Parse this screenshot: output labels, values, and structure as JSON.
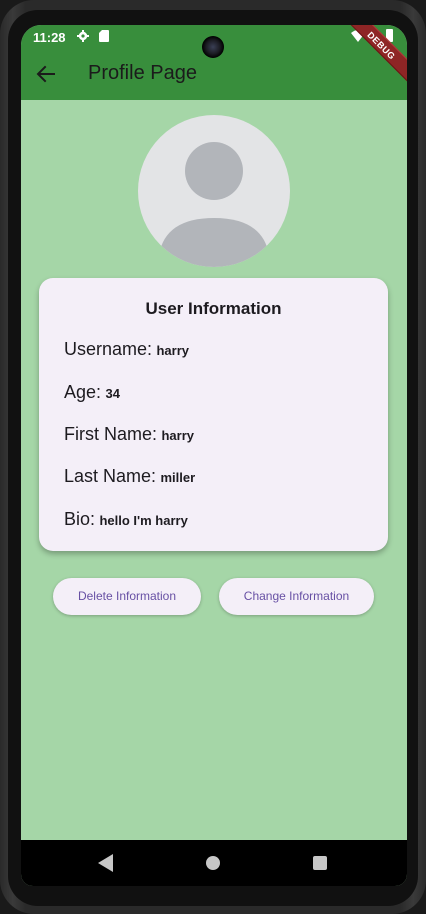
{
  "status_bar": {
    "time": "11:28",
    "debug_banner": "DEBUG"
  },
  "app_bar": {
    "title": "Profile Page",
    "back_icon": "arrow-left-icon"
  },
  "avatar": {
    "icon": "person-icon"
  },
  "card": {
    "title": "User Information",
    "rows": [
      {
        "label": "Username:",
        "value": "harry"
      },
      {
        "label": "Age:",
        "value": "34"
      },
      {
        "label": "First Name:",
        "value": "harry"
      },
      {
        "label": "Last Name:",
        "value": "miller"
      },
      {
        "label": "Bio:",
        "value": "hello I'm harry"
      }
    ]
  },
  "buttons": {
    "delete_label": "Delete Information",
    "change_label": "Change Information"
  },
  "colors": {
    "app_bar": "#388e3c",
    "background": "#a5d6a7",
    "card": "#f4eff8",
    "button_text": "#6750a4"
  }
}
